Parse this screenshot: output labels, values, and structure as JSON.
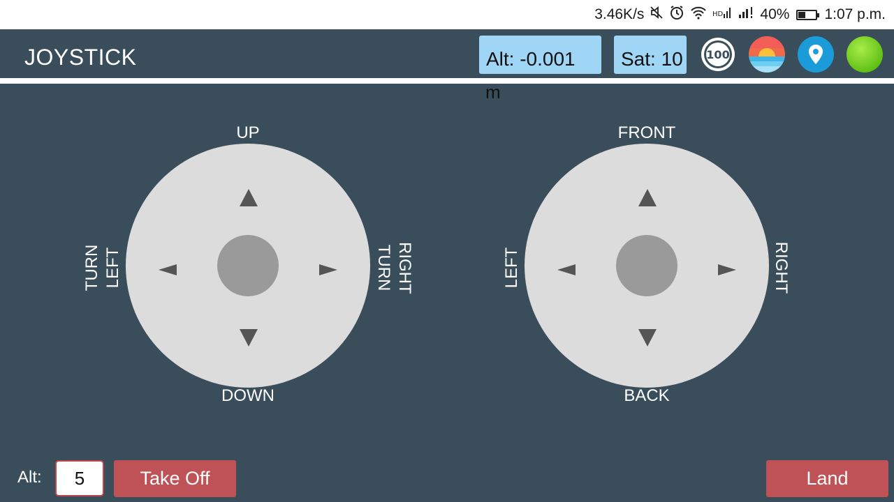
{
  "status_bar": {
    "speed": "3.46K/s",
    "battery": "40%",
    "battery_level": 0.4,
    "time": "1:07 p.m.",
    "icons": [
      "mute-icon",
      "alarm-icon",
      "wifi-icon",
      "hd-signal-icon",
      "signal-icon"
    ]
  },
  "app_bar": {
    "title": "JOYSTICK",
    "altitude": "Alt:   -0.001",
    "altitude_unit": "m",
    "satellites": "Sat: 10",
    "speed_badge": "100",
    "connection_color": "#7ed321"
  },
  "left_pad": {
    "up": "UP",
    "down": "DOWN",
    "left": "TURN LEFT",
    "right": "RIGHT TURN"
  },
  "right_pad": {
    "front": "FRONT",
    "back": "BACK",
    "left": "LEFT",
    "right": "RIGHT"
  },
  "controls": {
    "alt_label": "Alt:",
    "alt_value": "5",
    "takeoff": "Take Off",
    "land": "Land"
  },
  "colors": {
    "background": "#3a4d5a",
    "info_box": "#9fd6f5",
    "button": "#bf5256",
    "pad": "#dcdcdc"
  }
}
